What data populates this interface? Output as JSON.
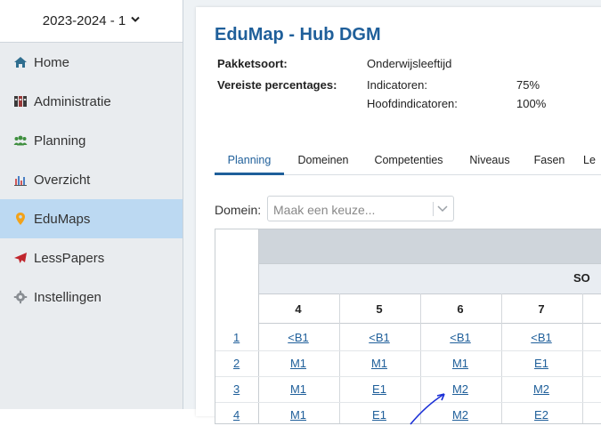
{
  "sidebar": {
    "year": "2023-2024 - 1",
    "items": [
      {
        "label": "Home",
        "icon": "home-icon"
      },
      {
        "label": "Administratie",
        "icon": "binders-icon"
      },
      {
        "label": "Planning",
        "icon": "users-icon"
      },
      {
        "label": "Overzicht",
        "icon": "bar-chart-icon"
      },
      {
        "label": "EduMaps",
        "icon": "map-pin-icon",
        "active": true
      },
      {
        "label": "LessPapers",
        "icon": "paper-plane-icon"
      },
      {
        "label": "Instellingen",
        "icon": "gear-icon"
      }
    ]
  },
  "page": {
    "title": "EduMap - Hub DGM",
    "pakketsoort_label": "Pakketsoort:",
    "pakketsoort_value": "Onderwijsleeftijd",
    "vereiste_label": "Vereiste percentages:",
    "indicatoren_label": "Indicatoren:",
    "indicatoren_value": "75%",
    "hoofdindicatoren_label": "Hoofdindicatoren:",
    "hoofdindicatoren_value": "100%"
  },
  "tabs": [
    "Planning",
    "Domeinen",
    "Competenties",
    "Niveaus",
    "Fasen",
    "Le"
  ],
  "domain": {
    "label": "Domein:",
    "placeholder": "Maak een keuze..."
  },
  "grid": {
    "group_label": "SO",
    "columns": [
      "4",
      "5",
      "6",
      "7"
    ],
    "rows": [
      {
        "num": "1",
        "cells": [
          "<B1",
          "<B1",
          "<B1",
          "<B1"
        ]
      },
      {
        "num": "2",
        "cells": [
          "M1",
          "M1",
          "M1",
          "E1"
        ]
      },
      {
        "num": "3",
        "cells": [
          "M1",
          "E1",
          "M2",
          "M2"
        ]
      },
      {
        "num": "4",
        "cells": [
          "M1",
          "E1",
          "M2",
          "E2"
        ]
      }
    ]
  },
  "colors": {
    "accent": "#1f5f9a",
    "sidebar_bg": "#e9ecef",
    "active_bg": "#bcd9f2",
    "annotation_arrow": "#1a2fd6"
  }
}
